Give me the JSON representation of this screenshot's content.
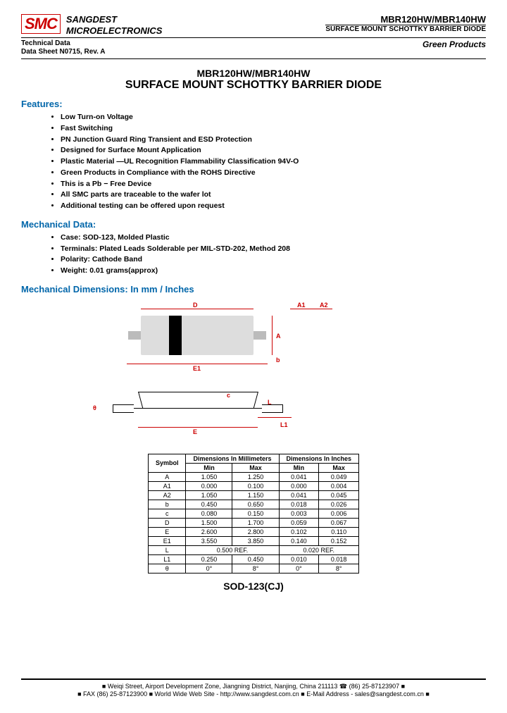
{
  "header": {
    "logo": "SMC",
    "company_l1": "SANGDEST",
    "company_l2": "MICROELECTRONICS",
    "part_no": "MBR120HW/MBR140HW",
    "prod_type": "SURFACE MOUNT SCHOTTKY BARRIER DIODE",
    "tech_l1": "Technical Data",
    "tech_l2": "Data Sheet N0715, Rev. A",
    "green": "Green Products"
  },
  "title": {
    "pn": "MBR120HW/MBR140HW",
    "pt": "SURFACE MOUNT SCHOTTKY BARRIER DIODE"
  },
  "sections": {
    "features": "Features:",
    "mech_data": "Mechanical Data:",
    "mech_dim": "Mechanical Dimensions: In mm / Inches"
  },
  "features": [
    "Low Turn-on Voltage",
    "Fast Switching",
    "PN Junction Guard Ring Transient and ESD Protection",
    "Designed for Surface Mount Application",
    "Plastic Material —UL Recognition Flammability Classification 94V-O",
    "Green Products in Compliance with the ROHS Directive",
    "This is a Pb − Free Device",
    "All SMC parts are traceable to the wafer lot",
    "Additional testing can be offered upon request"
  ],
  "mech_data": [
    "Case: SOD-123, Molded Plastic",
    "Terminals: Plated Leads Solderable per MIL-STD-202, Method 208",
    "Polarity: Cathode Band",
    "Weight: 0.01 grams(approx)"
  ],
  "diagram_labels": {
    "D": "D",
    "A1": "A1",
    "A2": "A2",
    "A": "A",
    "b": "b",
    "E1": "E1",
    "E": "E",
    "theta": "θ",
    "c": "c",
    "L": "L",
    "L1": "L1"
  },
  "table": {
    "head_symbol": "Symbol",
    "head_mm": "Dimensions In Millimeters",
    "head_in": "Dimensions In Inches",
    "head_min": "Min",
    "head_max": "Max",
    "rows": [
      {
        "s": "A",
        "mm_min": "1.050",
        "mm_max": "1.250",
        "in_min": "0.041",
        "in_max": "0.049"
      },
      {
        "s": "A1",
        "mm_min": "0.000",
        "mm_max": "0.100",
        "in_min": "0.000",
        "in_max": "0.004"
      },
      {
        "s": "A2",
        "mm_min": "1.050",
        "mm_max": "1.150",
        "in_min": "0.041",
        "in_max": "0.045"
      },
      {
        "s": "b",
        "mm_min": "0.450",
        "mm_max": "0.650",
        "in_min": "0.018",
        "in_max": "0.026"
      },
      {
        "s": "c",
        "mm_min": "0.080",
        "mm_max": "0.150",
        "in_min": "0.003",
        "in_max": "0.006"
      },
      {
        "s": "D",
        "mm_min": "1.500",
        "mm_max": "1.700",
        "in_min": "0.059",
        "in_max": "0.067"
      },
      {
        "s": "E",
        "mm_min": "2.600",
        "mm_max": "2.800",
        "in_min": "0.102",
        "in_max": "0.110"
      },
      {
        "s": "E1",
        "mm_min": "3.550",
        "mm_max": "3.850",
        "in_min": "0.140",
        "in_max": "0.152"
      }
    ],
    "ref_rows": [
      {
        "s": "L",
        "mm": "0.500 REF.",
        "in": "0.020 REF."
      }
    ],
    "tail_rows": [
      {
        "s": "L1",
        "mm_min": "0.250",
        "mm_max": "0.450",
        "in_min": "0.010",
        "in_max": "0.018"
      },
      {
        "s": "θ",
        "mm_min": "0°",
        "mm_max": "8°",
        "in_min": "0°",
        "in_max": "8°"
      }
    ]
  },
  "package": "SOD-123(CJ)",
  "footer": {
    "l1": "■ Weiqi Street, Airport Development Zone, Jiangning District, Nanjing, China 211113 ☎ (86) 25-87123907 ■",
    "l2": "■ FAX (86) 25-87123900 ■ World Wide Web Site - http://www.sangdest.com.cn ■ E-Mail Address - sales@sangdest.com.cn ■"
  }
}
